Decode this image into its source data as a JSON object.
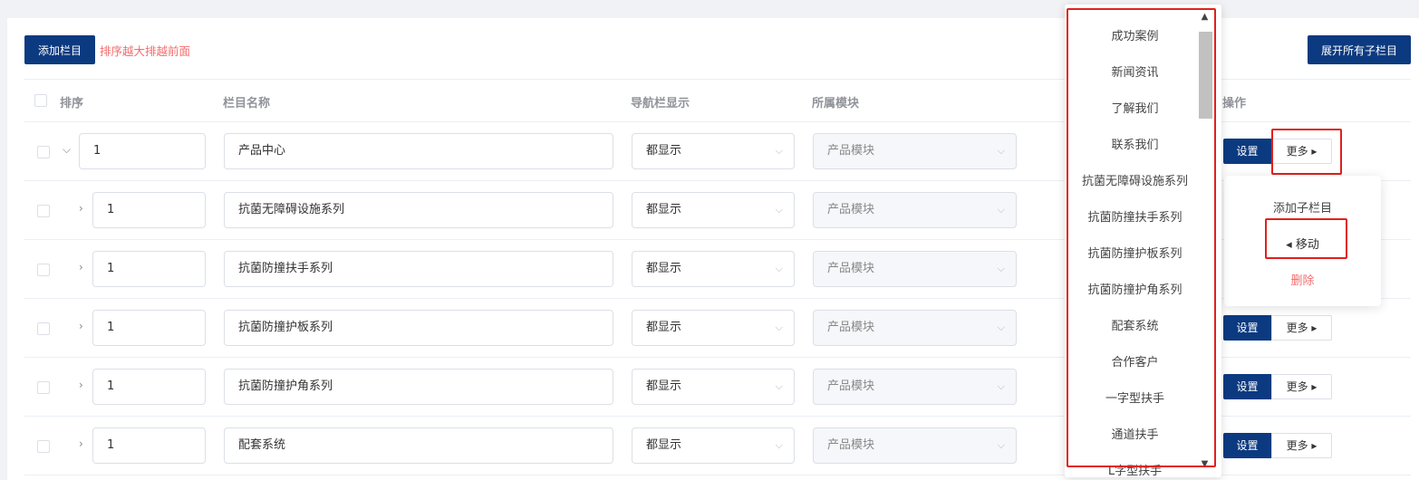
{
  "toolbar": {
    "add_label": "添加栏目",
    "hint": "排序越大排越前面",
    "expand_all_label": "展开所有子栏目"
  },
  "columns": {
    "sort": "排序",
    "name": "栏目名称",
    "nav": "导航栏显示",
    "module": "所属模块",
    "actions": "操作"
  },
  "rows": [
    {
      "sort": "1",
      "name": "产品中心",
      "nav": "都显示",
      "module": "产品模块",
      "expanded": true
    },
    {
      "sort": "1",
      "name": "抗菌无障碍设施系列",
      "nav": "都显示",
      "module": "产品模块"
    },
    {
      "sort": "1",
      "name": "抗菌防撞扶手系列",
      "nav": "都显示",
      "module": "产品模块"
    },
    {
      "sort": "1",
      "name": "抗菌防撞护板系列",
      "nav": "都显示",
      "module": "产品模块"
    },
    {
      "sort": "1",
      "name": "抗菌防撞护角系列",
      "nav": "都显示",
      "module": "产品模块"
    },
    {
      "sort": "1",
      "name": "配套系统",
      "nav": "都显示",
      "module": "产品模块"
    }
  ],
  "actions": {
    "settings_label": "设置",
    "more_label": "更多"
  },
  "more_menu": {
    "add_child": "添加子栏目",
    "move": "移动",
    "delete": "删除"
  },
  "move_dropdown": {
    "items": [
      "成功案例",
      "新闻资讯",
      "了解我们",
      "联系我们",
      "抗菌无障碍设施系列",
      "抗菌防撞扶手系列",
      "抗菌防撞护板系列",
      "抗菌防撞护角系列",
      "配套系统",
      "合作客户",
      "一字型扶手",
      "通道扶手",
      "L字型扶手"
    ]
  },
  "colors": {
    "primary": "#0c3a80",
    "danger": "#f56c6c",
    "highlight": "#e0211c"
  }
}
